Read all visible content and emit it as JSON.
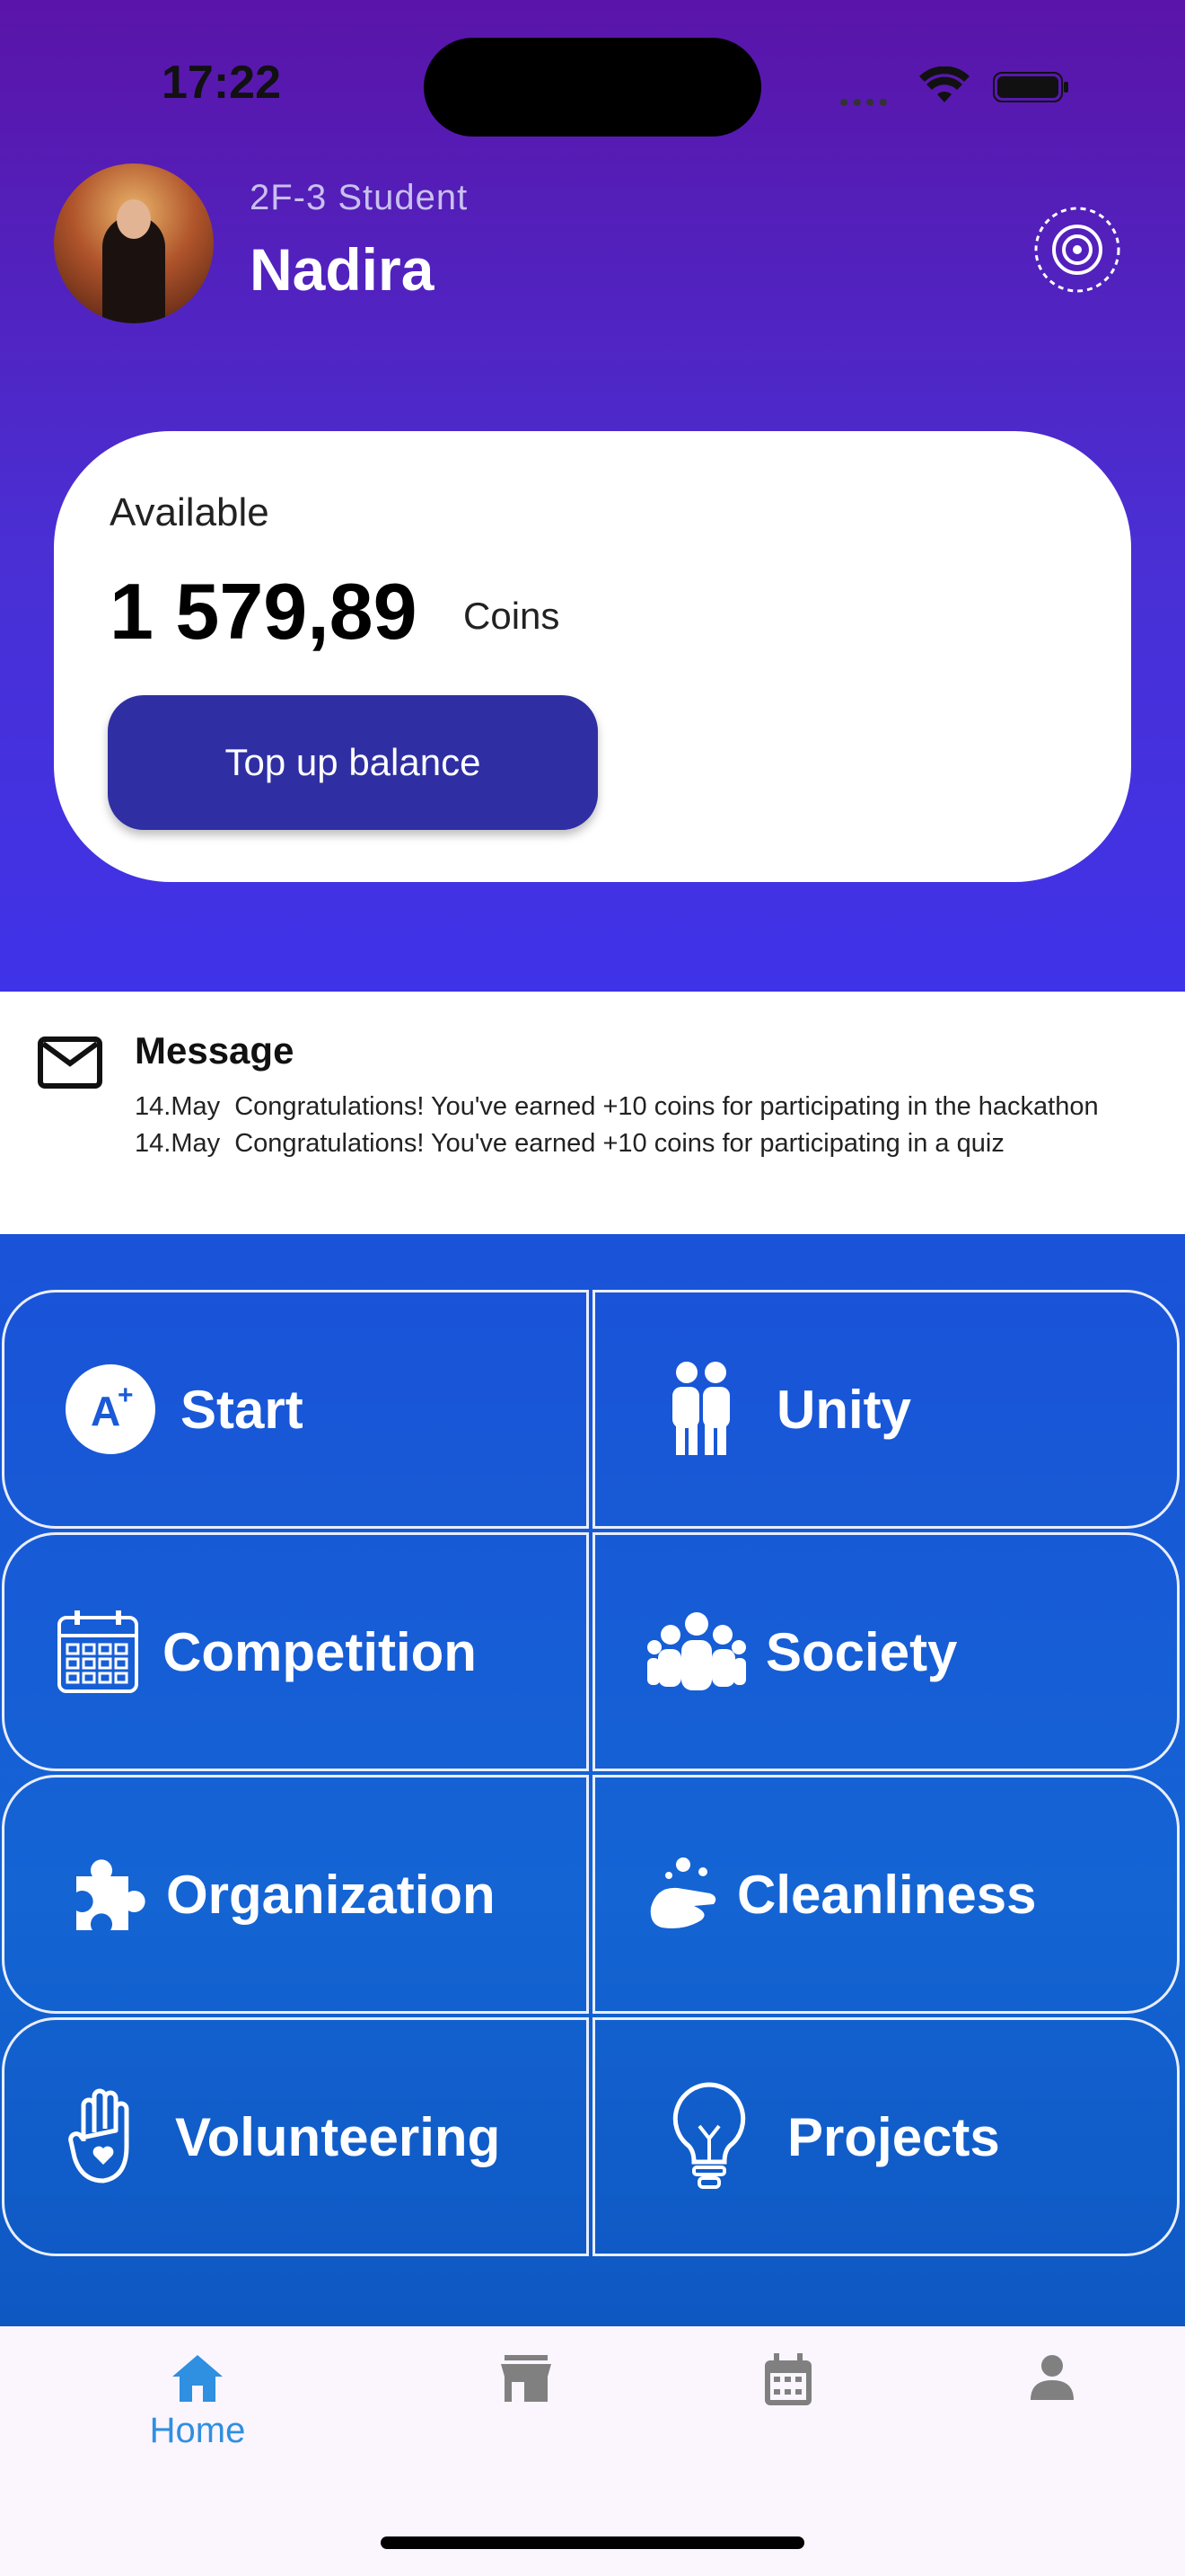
{
  "status_bar": {
    "time": "17:22",
    "dots": "••••"
  },
  "profile": {
    "role": "2F-3 Student",
    "name": "Nadira"
  },
  "balance": {
    "label": "Available",
    "amount": "1 579,89",
    "unit": "Coins",
    "button_label": "Top up balance"
  },
  "message": {
    "title": "Message",
    "items": [
      {
        "date": "14.May",
        "text": "Congratulations! You've earned +10 coins for participating in the hackathon"
      },
      {
        "date": "14.May",
        "text": "Congratulations! You've earned +10 coins for participating in a quiz"
      }
    ]
  },
  "categories": [
    {
      "label": "Start",
      "icon": "a-plus-icon"
    },
    {
      "label": "Unity",
      "icon": "people-hug-icon"
    },
    {
      "label": "Competition",
      "icon": "calendar-grid-icon"
    },
    {
      "label": "Society",
      "icon": "group-icon"
    },
    {
      "label": "Organization",
      "icon": "puzzle-icon"
    },
    {
      "label": "Cleanliness",
      "icon": "washing-hands-icon"
    },
    {
      "label": "Volunteering",
      "icon": "hand-heart-icon"
    },
    {
      "label": "Projects",
      "icon": "lightbulb-icon"
    }
  ],
  "bottom_nav": [
    {
      "label": "Home",
      "icon": "home-icon",
      "active": true
    },
    {
      "label": "",
      "icon": "store-icon",
      "active": false
    },
    {
      "label": "",
      "icon": "calendar-icon",
      "active": false
    },
    {
      "label": "",
      "icon": "person-icon",
      "active": false
    }
  ],
  "colors": {
    "accent": "#2f8fe0",
    "button": "#2f2fa3",
    "grid_bg": "#1464d4"
  }
}
